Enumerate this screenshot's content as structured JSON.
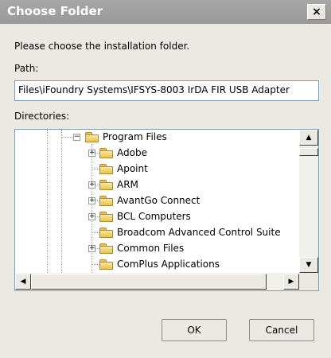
{
  "window": {
    "title": "Choose Folder",
    "close_glyph": "×"
  },
  "prompt": "Please choose the installation folder.",
  "path_label": "Path:",
  "path_value": "Files\\iFoundry Systems\\IFSYS-8003 IrDA FIR USB Adapter",
  "directories_label": "Directories:",
  "tree": {
    "items": [
      {
        "label": "Program Files",
        "expander": "−",
        "level": 0
      },
      {
        "label": "Adobe",
        "expander": "+",
        "level": 1
      },
      {
        "label": "Apoint",
        "expander": "",
        "level": 1
      },
      {
        "label": "ARM",
        "expander": "+",
        "level": 1
      },
      {
        "label": "AvantGo Connect",
        "expander": "+",
        "level": 1
      },
      {
        "label": "BCL Computers",
        "expander": "+",
        "level": 1
      },
      {
        "label": "Broadcom Advanced Control Suite",
        "expander": "",
        "level": 1
      },
      {
        "label": "Common Files",
        "expander": "+",
        "level": 1
      },
      {
        "label": "ComPlus Applications",
        "expander": "",
        "level": 1
      }
    ]
  },
  "scroll": {
    "up": "▲",
    "down": "▼",
    "left": "◀",
    "right": "▶"
  },
  "buttons": {
    "ok": "OK",
    "cancel": "Cancel"
  },
  "icons": {
    "folder": "folder-icon",
    "expander": "tree-expander-icon"
  }
}
